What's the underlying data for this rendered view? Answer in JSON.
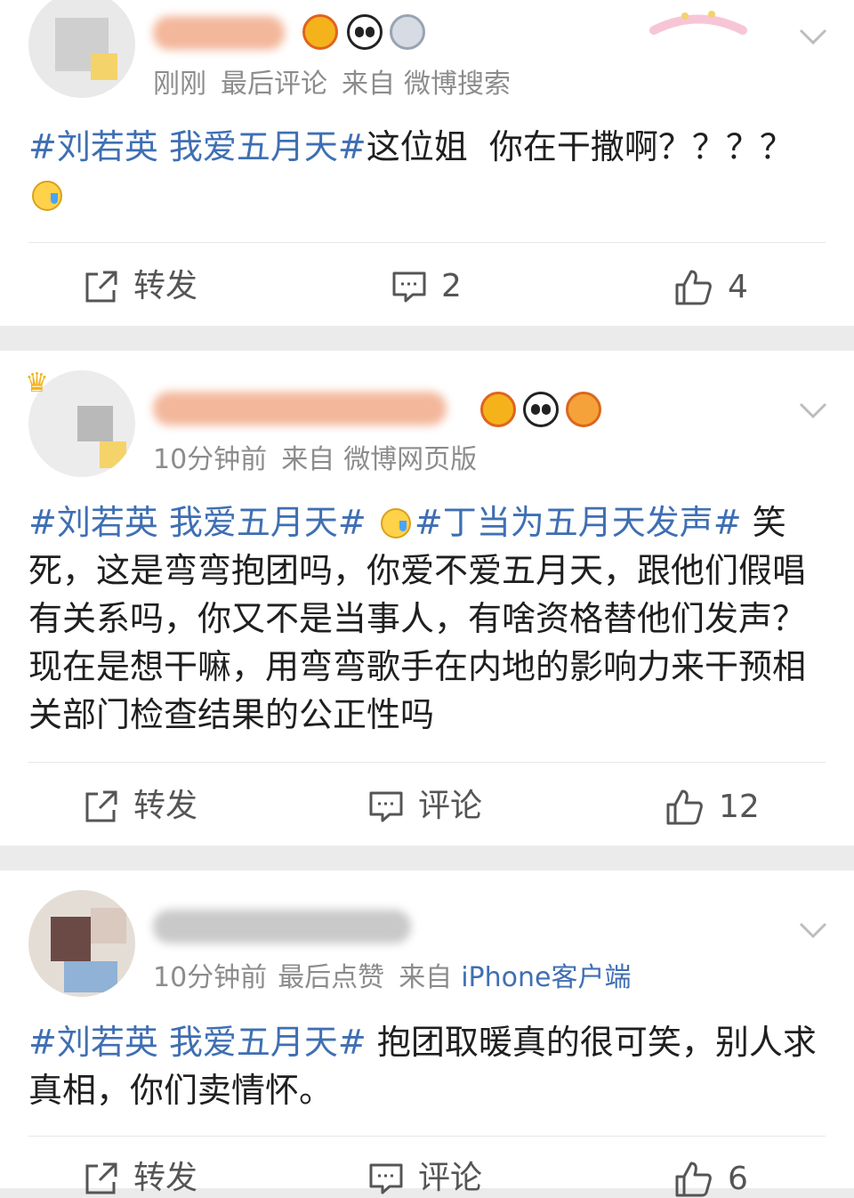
{
  "posts": [
    {
      "time": "刚刚",
      "extra": "最后评论",
      "source_prefix": "来自",
      "source": "微博搜索",
      "tag1": "#刘若英 我爱五月天#",
      "text1": "这位姐  你在干撒啊？？？？",
      "tag2": "",
      "text2": "",
      "repost_label": "转发",
      "comment_label": "2",
      "like_count": "4"
    },
    {
      "time": "10分钟前",
      "extra": "",
      "source_prefix": "来自",
      "source": "微博网页版",
      "tag1": "#刘若英 我爱五月天#",
      "text1": "",
      "tag2": "#丁当为五月天发声#",
      "text2": "笑死，这是弯弯抱团吗，你爱不爱五月天，跟他们假唱有关系吗，你又不是当事人，有啥资格替他们发声？现在是想干嘛，用弯弯歌手在内地的影响力来干预相关部门检查结果的公正性吗",
      "repost_label": "转发",
      "comment_label": "评论",
      "like_count": "12"
    },
    {
      "time": "10分钟前",
      "extra": "最后点赞",
      "source_prefix": "来自",
      "source": "iPhone客户端",
      "tag1": "#刘若英 我爱五月天#",
      "text1": " 抱团取暖真的很可笑，别人求真相，你们卖情怀。",
      "tag2": "",
      "text2": "",
      "repost_label": "转发",
      "comment_label": "评论",
      "like_count": "6"
    }
  ],
  "colors": {
    "link": "#3f6fb3",
    "meta": "#8c8c8c",
    "separator": "#ebebeb"
  },
  "icons": [
    "share-icon",
    "comment-icon",
    "like-icon",
    "chevron-down-icon",
    "vip-crown-icon",
    "panda-badge-icon",
    "medal-badge-icon",
    "emoji-icon"
  ]
}
